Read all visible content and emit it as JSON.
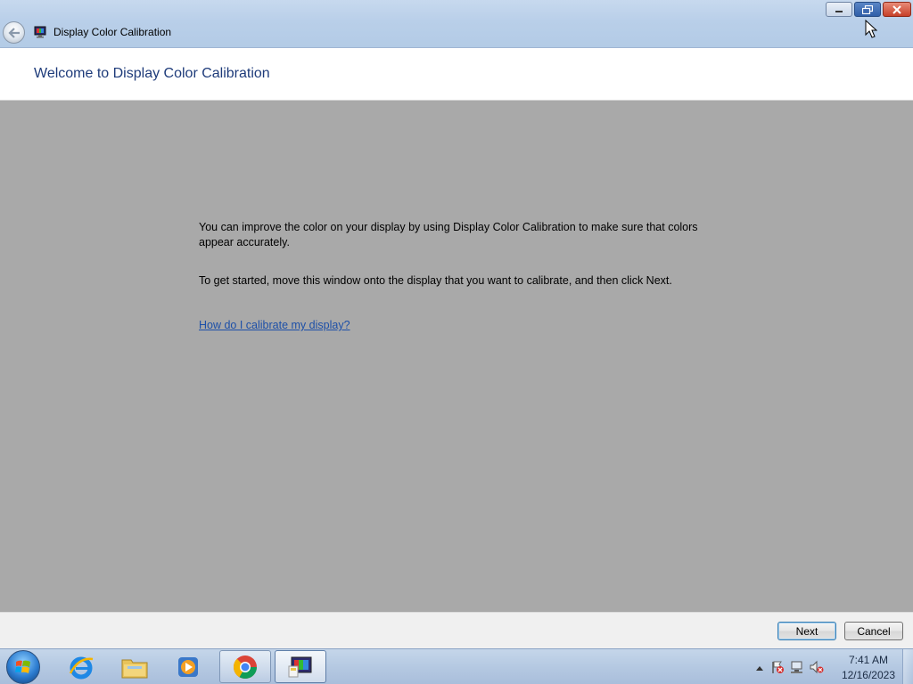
{
  "window": {
    "title": "Display Color Calibration"
  },
  "header": {
    "page_title": "Welcome to Display Color Calibration"
  },
  "content": {
    "paragraph1": "You can improve the color on your display by using Display Color Calibration to make sure that colors appear accurately.",
    "paragraph2": "To get started, move this window onto the display that you want to calibrate, and then click Next.",
    "help_link": "How do I calibrate my display?"
  },
  "buttons": {
    "next_label": "Next",
    "cancel_label": "Cancel"
  },
  "taskbar": {
    "pinned": [
      {
        "name": "internet-explorer-icon"
      },
      {
        "name": "windows-explorer-icon"
      },
      {
        "name": "windows-media-player-icon"
      },
      {
        "name": "chrome-icon"
      },
      {
        "name": "display-color-calibration-icon",
        "active": true
      }
    ],
    "clock": {
      "time": "7:41 AM",
      "date": "12/16/2023"
    }
  },
  "colors": {
    "content_background": "#a9a9a9",
    "title_text": "#1e3b7a",
    "link": "#1c4fa8"
  }
}
